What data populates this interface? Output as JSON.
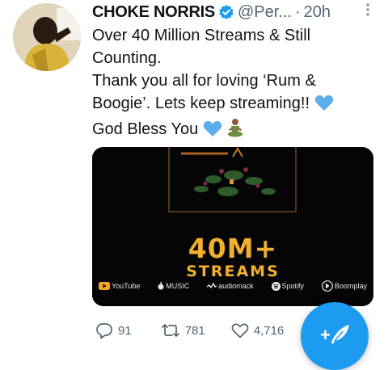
{
  "tweet": {
    "display_name": "CHOKE NORRIS",
    "handle": "@Per...",
    "separator": "·",
    "time": "20h",
    "text_line1": "Over 40 Million Streams & Still Counting.",
    "text_line2": "Thank you all for loving ‘Rum & Boogie’. Lets keep streaming!!",
    "text_line3": "God Bless You"
  },
  "media": {
    "headline": "40M+",
    "subheadline": "STREAMS",
    "platforms": [
      "YouTube",
      "MUSIC",
      "audiomack",
      "Spotify",
      "Boomplay"
    ]
  },
  "actions": {
    "replies": "91",
    "retweets": "781",
    "likes": "4,716"
  },
  "colors": {
    "accent": "#1d9bf0",
    "text": "#0f1419",
    "muted": "#536471",
    "gold": "#f2b02e"
  }
}
